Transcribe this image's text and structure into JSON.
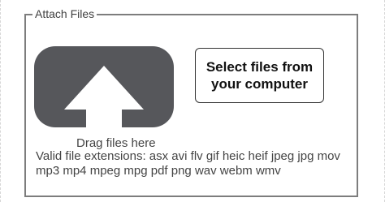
{
  "panel": {
    "legend": "Attach Files"
  },
  "dropzone": {
    "icon": "upload-arrow-icon",
    "label": "Drag files here",
    "extensions_text": "Valid file extensions: asx avi flv gif heic heif jpeg jpg mov mp3 mp4 mpeg mpg pdf png wav webm wmv"
  },
  "select_button": {
    "label": "Select files from your computer"
  },
  "colors": {
    "icon_body": "#56575b",
    "border": "#7d7d7d",
    "text": "#444444"
  }
}
